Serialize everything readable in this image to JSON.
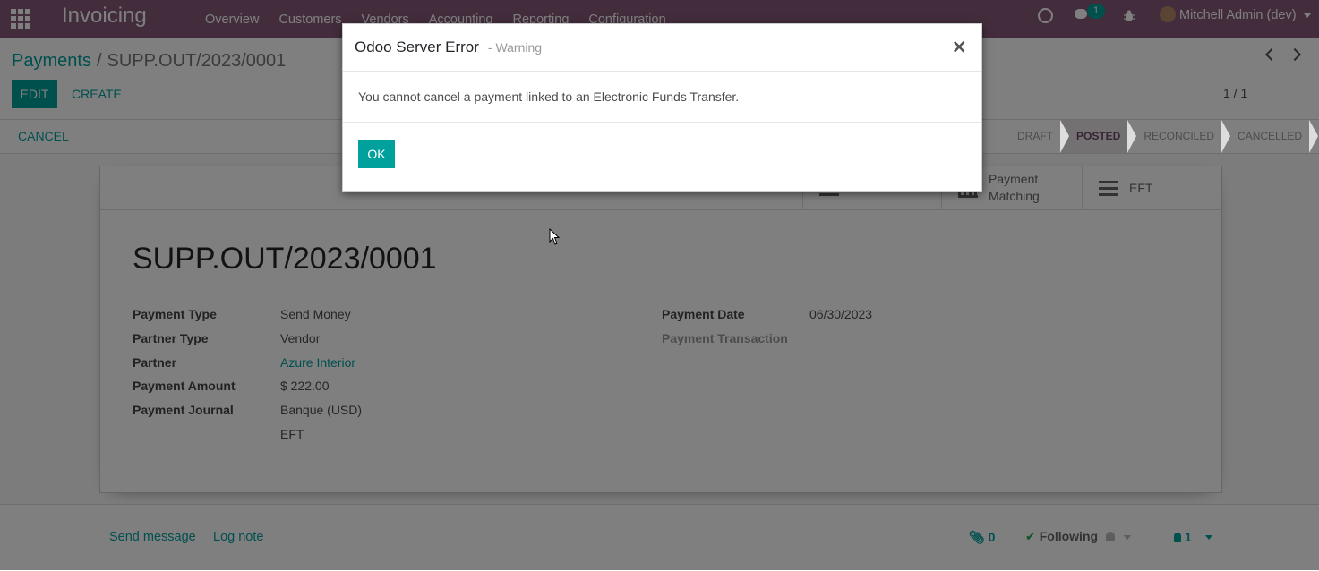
{
  "navbar": {
    "app_name": "Invoicing",
    "menu": [
      "Overview",
      "Customers",
      "Vendors",
      "Accounting",
      "Reporting",
      "Configuration"
    ],
    "chat_count": "1",
    "user": "Mitchell Admin (dev)",
    "color": "#875a7b"
  },
  "breadcrumb": {
    "parent": "Payments",
    "current": "SUPP.OUT/2023/0001"
  },
  "buttons": {
    "edit": "EDIT",
    "create": "CREATE",
    "cancel": "CANCEL"
  },
  "pager": {
    "value": "1 / 1"
  },
  "statusbar": {
    "stages": [
      "DRAFT",
      "POSTED",
      "RECONCILED",
      "CANCELLED"
    ],
    "active": "POSTED"
  },
  "smart_buttons": {
    "journal_items": "Journal Items",
    "payment_matching_1": "Payment",
    "payment_matching_2": "Matching",
    "eft": "EFT"
  },
  "record": {
    "name": "SUPP.OUT/2023/0001",
    "fields": {
      "payment_type_label": "Payment Type",
      "payment_type": "Send Money",
      "partner_type_label": "Partner Type",
      "partner_type": "Vendor",
      "partner_label": "Partner",
      "partner": "Azure Interior",
      "amount_label": "Payment Amount",
      "amount": "$ 222.00",
      "journal_label": "Payment Journal",
      "journal": "Banque (USD)",
      "method": "EFT",
      "date_label": "Payment Date",
      "date": "06/30/2023",
      "transaction_label": "Payment Transaction"
    }
  },
  "chatter": {
    "send_message": "Send message",
    "log_note": "Log note",
    "attachments": "0",
    "following": "Following",
    "followers": "1"
  },
  "modal": {
    "title": "Odoo Server Error",
    "subtitle": "- Warning",
    "close": "×",
    "message": "You cannot cancel a payment linked to an Electronic Funds Transfer.",
    "ok": "OK"
  },
  "accent": "#00a09d"
}
